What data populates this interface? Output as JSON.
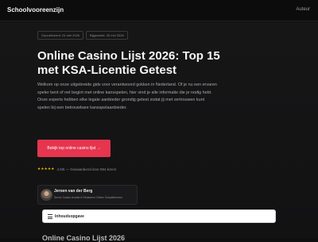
{
  "header": {
    "brand": "Schoolvooreenzijn",
    "nav_auteur": "Auteur"
  },
  "hero": {
    "dates": {
      "published": "Gepubliceerd: 24 mei 2026",
      "updated": "Bijgewerkt: 25 mei 2026"
    },
    "title": "Online Casino Lijst 2026: Top 15 met KSA-Licentie Getest",
    "intro": "Welkom op onze uitgebreide gids voor verantwoord gokken in Nederland. Of je nu een ervaren speler bent of net begint met online kansspelen, hier vind je alle informatie die je nodig hebt. Onze experts hebben elke legale aanbieder grondig getest zodat jij met vertrouwen kunt spelen bij een betrouwbare kansspelaanbieder.",
    "cta_label": "Bekijk top online casino lijst →",
    "rating": {
      "stars": "★★★★★",
      "text": "4.9/5 — Gewaardeerd door 894 lezers"
    },
    "author": {
      "name": "Jeroen van der Berg",
      "role": "Senior Casino Analist & Redacteur Online Gokplatformen"
    }
  },
  "toc": {
    "label": "Inhoudsopgave"
  },
  "next_section": {
    "heading": "Online Casino Lijst 2026"
  }
}
